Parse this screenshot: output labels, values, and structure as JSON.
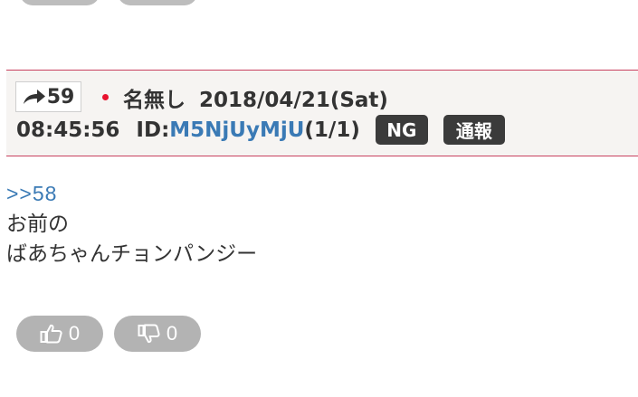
{
  "post": {
    "number": "59",
    "name": "名無し",
    "date": "2018/04/21(Sat)",
    "time": "08:45:56",
    "id_label": "ID:",
    "id_value": "M5NjUyMjU",
    "id_count": "(1/1)",
    "ng_label": "NG",
    "report_label": "通報",
    "anchor": ">>58",
    "body_lines": [
      "お前の",
      "ばあちゃんチョンパンジー"
    ],
    "likes": "0",
    "dislikes": "0"
  },
  "colors": {
    "border_accent": "#c8415f",
    "link": "#3a7ab5",
    "tag_bg": "#3b3b3b",
    "vote_bg": "#b3b3b3",
    "flag_red": "#e8122e"
  }
}
